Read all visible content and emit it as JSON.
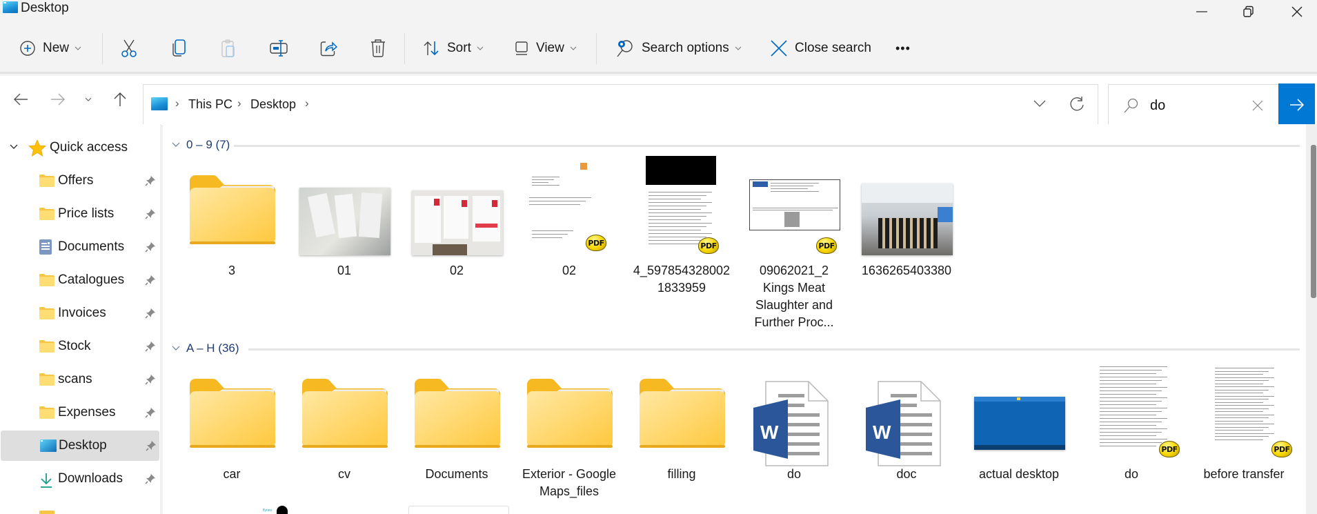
{
  "window": {
    "title": "Desktop",
    "minimize_icon": "minimize-icon",
    "maximize_icon": "restore-icon",
    "close_icon": "close-icon"
  },
  "toolbar": {
    "new_label": "New",
    "cut_icon": "scissors-icon",
    "copy_icon": "copy-icon",
    "paste_icon": "paste-icon",
    "rename_icon": "rename-icon",
    "share_icon": "share-icon",
    "delete_icon": "trash-icon",
    "sort_label": "Sort",
    "view_label": "View",
    "search_options_label": "Search options",
    "close_search_label": "Close search",
    "more_label": "•••"
  },
  "address": {
    "breadcrumb": [
      "This PC",
      "Desktop"
    ],
    "separator": "›"
  },
  "search": {
    "value": "do",
    "placeholder": ""
  },
  "sidebar": {
    "quick_access_label": "Quick access",
    "items": [
      {
        "label": "Offers",
        "icon": "folder",
        "pinned": true
      },
      {
        "label": "Price lists",
        "icon": "folder",
        "pinned": true
      },
      {
        "label": "Documents",
        "icon": "documents",
        "pinned": true
      },
      {
        "label": "Catalogues",
        "icon": "folder",
        "pinned": true
      },
      {
        "label": "Invoices",
        "icon": "folder",
        "pinned": true
      },
      {
        "label": "Stock",
        "icon": "folder",
        "pinned": true
      },
      {
        "label": "scans",
        "icon": "folder",
        "pinned": true
      },
      {
        "label": "Expenses",
        "icon": "folder",
        "pinned": true
      },
      {
        "label": "Desktop",
        "icon": "desktop",
        "pinned": true,
        "selected": true
      },
      {
        "label": "Downloads",
        "icon": "download",
        "pinned": true
      }
    ]
  },
  "groups": [
    {
      "label": "0 – 9 (7)",
      "items": [
        {
          "name": "3",
          "type": "folder"
        },
        {
          "name": "01",
          "type": "photo"
        },
        {
          "name": "02",
          "type": "photo"
        },
        {
          "name": "02",
          "type": "pdf"
        },
        {
          "name": "4_5978543280021833959",
          "display_lines": [
            "4_597854328002",
            "1833959"
          ],
          "type": "pdf"
        },
        {
          "name": "09062021_2 Kings Meat Slaughter and Further Proc...",
          "display_lines": [
            "09062021_2",
            "Kings Meat",
            "Slaughter and",
            "Further Proc..."
          ],
          "type": "pdf"
        },
        {
          "name": "1636265403380",
          "type": "photo"
        }
      ]
    },
    {
      "label": "A – H (36)",
      "items": [
        {
          "name": "car",
          "type": "folder"
        },
        {
          "name": "cv",
          "type": "folder"
        },
        {
          "name": "Documents",
          "type": "folder"
        },
        {
          "name": "Exterior - Google Maps_files",
          "display_lines": [
            "Exterior - Google",
            "Maps_files"
          ],
          "type": "folder"
        },
        {
          "name": "filling",
          "type": "folder"
        },
        {
          "name": "do",
          "type": "word"
        },
        {
          "name": "doc",
          "type": "word"
        },
        {
          "name": "actual desktop",
          "type": "image"
        },
        {
          "name": "do",
          "type": "pdf"
        },
        {
          "name": "before transfer",
          "type": "pdf"
        }
      ]
    }
  ],
  "colors": {
    "accent": "#0078d4",
    "group_header": "#1f3b73",
    "folder": "#ffd34f",
    "selected_bg": "#dedede"
  }
}
